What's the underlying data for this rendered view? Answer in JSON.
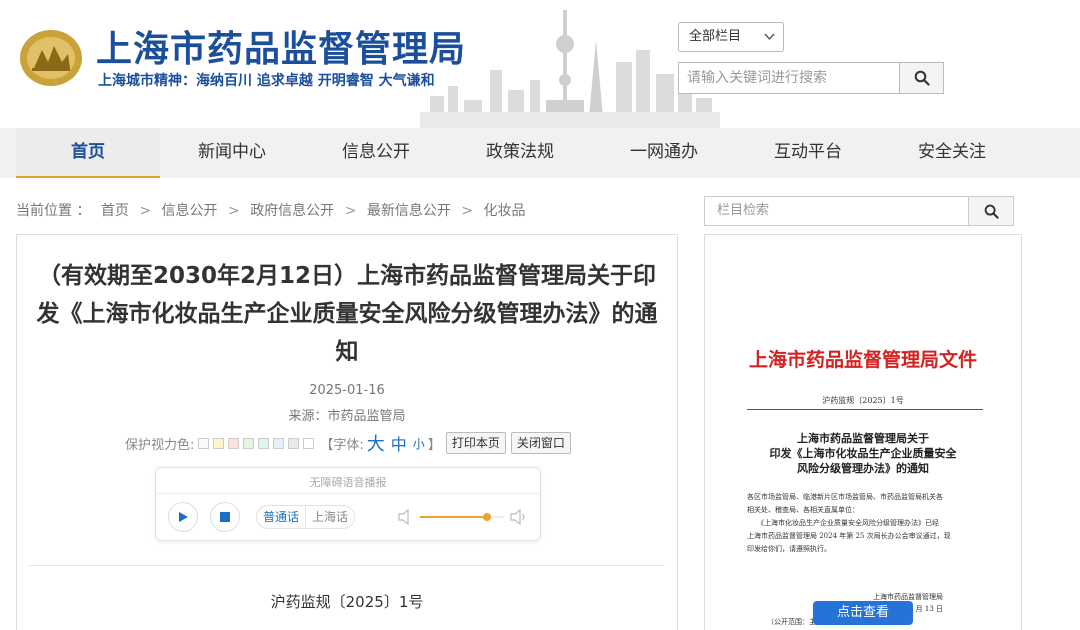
{
  "header": {
    "site_title": "上海市药品监督管理局",
    "slogan": "上海城市精神：海纳百川  追求卓越  开明睿智  大气谦和",
    "scope_select": "全部栏目",
    "search_placeholder": "请输入关键词进行搜索",
    "brand_color": "#1b4f9c",
    "logo_color": "#c9a23a"
  },
  "nav": {
    "items": [
      {
        "label": "首页",
        "active": true
      },
      {
        "label": "新闻中心"
      },
      {
        "label": "信息公开"
      },
      {
        "label": "政策法规"
      },
      {
        "label": "一网通办"
      },
      {
        "label": "互动平台"
      },
      {
        "label": "安全关注"
      }
    ]
  },
  "breadcrumb": {
    "prefix": "当前位置 ：",
    "items": [
      "首页",
      "信息公开",
      "政府信息公开",
      "最新信息公开",
      "化妆品"
    ]
  },
  "article": {
    "title": "（有效期至2030年2月12日）上海市药品监督管理局关于印发《上海市化妆品生产企业质量安全风险分级管理办法》的通知",
    "date": "2025-01-16",
    "source": "来源：市药品监管局",
    "eye_care_label": "保护视力色:",
    "eye_swatches": [
      "#fafafa",
      "#fff3cc",
      "#fde3dd",
      "#e7f4df",
      "#dff3f3",
      "#e6efff",
      "#e9e9e9",
      "#ffffff"
    ],
    "font_label_open": "【字体:",
    "font_large": "大",
    "font_medium": "中",
    "font_small": "小",
    "font_label_close": "】",
    "print_label": "打印本页",
    "close_label": "关闭窗口",
    "doc_number": "沪药监规〔2025〕1号"
  },
  "player": {
    "title": "无障碍语音播报",
    "lang_mandarin": "普通话",
    "lang_shanghai": "上海话",
    "volume": 0.8
  },
  "sidebar": {
    "search_placeholder": "栏目检索",
    "doc_header": "上海市药品监督管理局文件",
    "doc_no": "沪药监规〔2025〕1号",
    "doc_subtitle_1": "上海市药品监督管理局关于",
    "doc_subtitle_2": "印发《上海市化妆品生产企业质量安全",
    "doc_subtitle_3": "风险分级管理办法》的通知",
    "body_1": "各区市场监管局、临港新片区市场监管局、市药品监管局机关各",
    "body_2": "相关处、稽查局、各相关直属单位：",
    "body_3": "《上海市化妆品生产企业质量安全风险分级管理办法》已经",
    "body_4": "上海市药品监督管理局 2024 年第 25 次局长办公会审议通过，现",
    "body_5": "印发给你们，请遵照执行。",
    "sign_org": "上海市药品监督管理局",
    "sign_date": "1 月 13 日",
    "range": "（公开范围：主动公开）",
    "view_button": "点击查看"
  }
}
